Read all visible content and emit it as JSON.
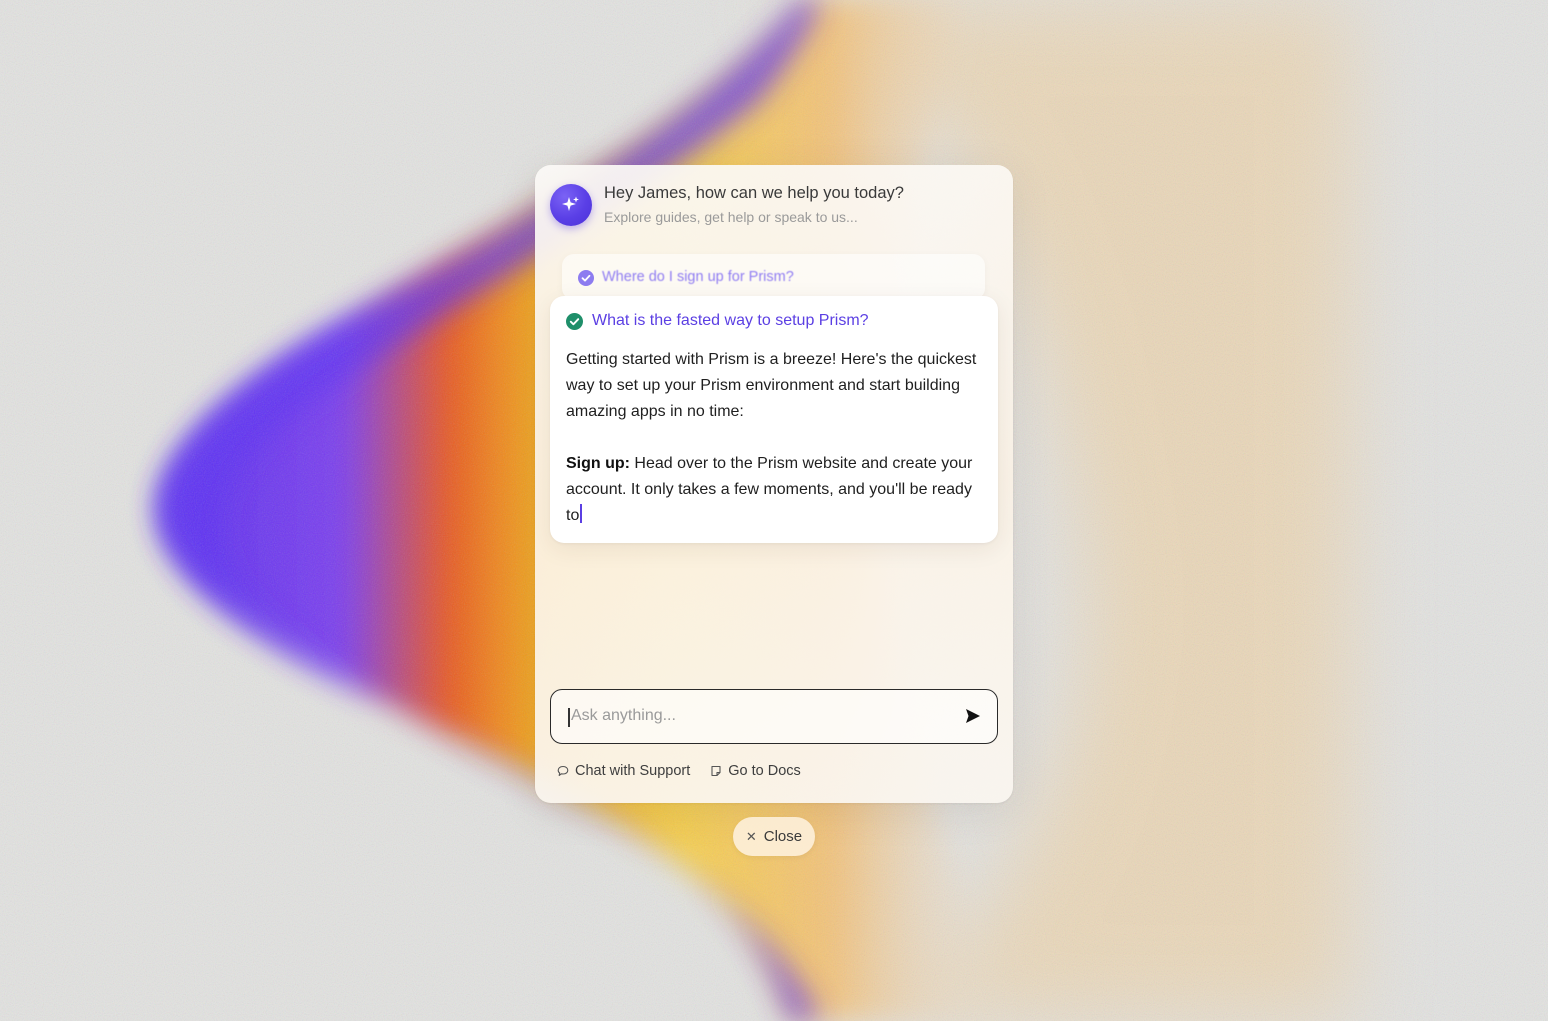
{
  "assistant": {
    "greeting": "Hey James, how can we help you today?",
    "subtitle": "Explore guides, get help or speak to us...",
    "avatar_icon": "sparkle-icon"
  },
  "conversation": {
    "previous_question": "Where do I sign up for Prism?",
    "current_question": "What is the fasted way to setup Prism?",
    "answer_intro": "Getting started with Prism is a breeze! Here's the quickest way to set up your Prism environment and start building amazing apps in no time:",
    "answer_step_label": "Sign up:",
    "answer_step_text": " Head over to the Prism website and create your account. It only takes a few moments, and you'll be ready to"
  },
  "input": {
    "placeholder": "Ask anything...",
    "value": "",
    "send_icon": "send-icon"
  },
  "links": {
    "support_label": "Chat with Support",
    "support_icon": "chat-bubble-icon",
    "docs_label": "Go to Docs",
    "docs_icon": "document-icon"
  },
  "close": {
    "label": "Close",
    "icon": "close-icon"
  },
  "colors": {
    "accent": "#5b3fe3",
    "check_green": "#1f8f6a",
    "background": "#e4e4e2"
  }
}
